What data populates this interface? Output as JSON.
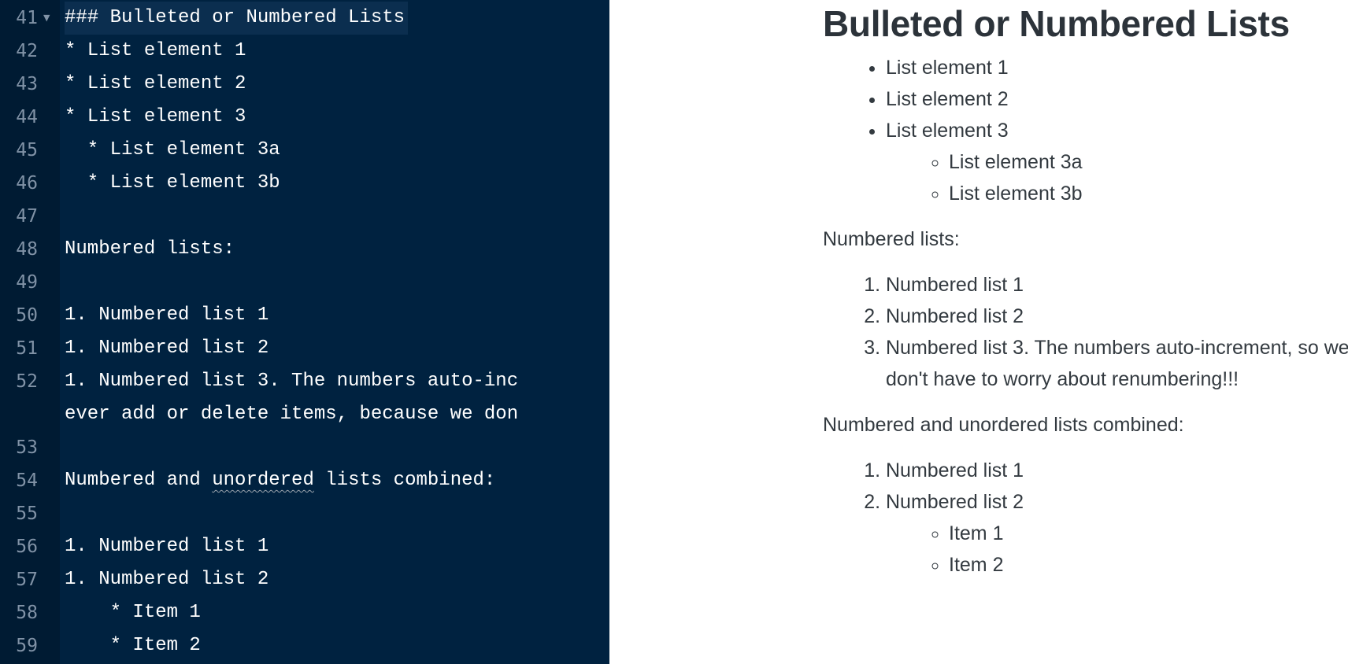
{
  "editor": {
    "lines": [
      {
        "num": "41",
        "text": "### Bulleted or Numbered Lists",
        "fold": true,
        "active": true
      },
      {
        "num": "42",
        "text": "* List element 1"
      },
      {
        "num": "43",
        "text": "* List element 2"
      },
      {
        "num": "44",
        "text": "* List element 3"
      },
      {
        "num": "45",
        "text": "  * List element 3a"
      },
      {
        "num": "46",
        "text": "  * List element 3b"
      },
      {
        "num": "47",
        "text": ""
      },
      {
        "num": "48",
        "text": "Numbered lists:"
      },
      {
        "num": "49",
        "text": ""
      },
      {
        "num": "50",
        "text": "1. Numbered list 1"
      },
      {
        "num": "51",
        "text": "1. Numbered list 2"
      },
      {
        "num": "52",
        "text": "1. Numbered list 3. The numbers auto-inc"
      },
      {
        "num": "",
        "text": "ever add or delete items, because we don"
      },
      {
        "num": "53",
        "text": ""
      },
      {
        "num": "54",
        "text": "Numbered and ",
        "squiggle": "unordered",
        "after": " lists combined:"
      },
      {
        "num": "55",
        "text": ""
      },
      {
        "num": "56",
        "text": "1. Numbered list 1"
      },
      {
        "num": "57",
        "text": "1. Numbered list 2"
      },
      {
        "num": "58",
        "text": "    * Item 1"
      },
      {
        "num": "59",
        "text": "    * Item 2"
      }
    ]
  },
  "preview": {
    "title": "Bulleted or Numbered Lists",
    "bullets": [
      "List element 1",
      "List element 2",
      "List element 3"
    ],
    "sub_bullets": [
      "List element 3a",
      "List element 3b"
    ],
    "numbered_heading": "Numbered lists:",
    "numbered": [
      "Numbered list 1",
      "Numbered list 2",
      "Numbered list 3. The numbers auto-increment, so we don't have to worry about renumbering!!!"
    ],
    "combined_heading": "Numbered and unordered lists combined:",
    "combined_numbered": [
      "Numbered list 1",
      "Numbered list 2"
    ],
    "combined_sub": [
      "Item 1",
      "Item 2"
    ]
  }
}
